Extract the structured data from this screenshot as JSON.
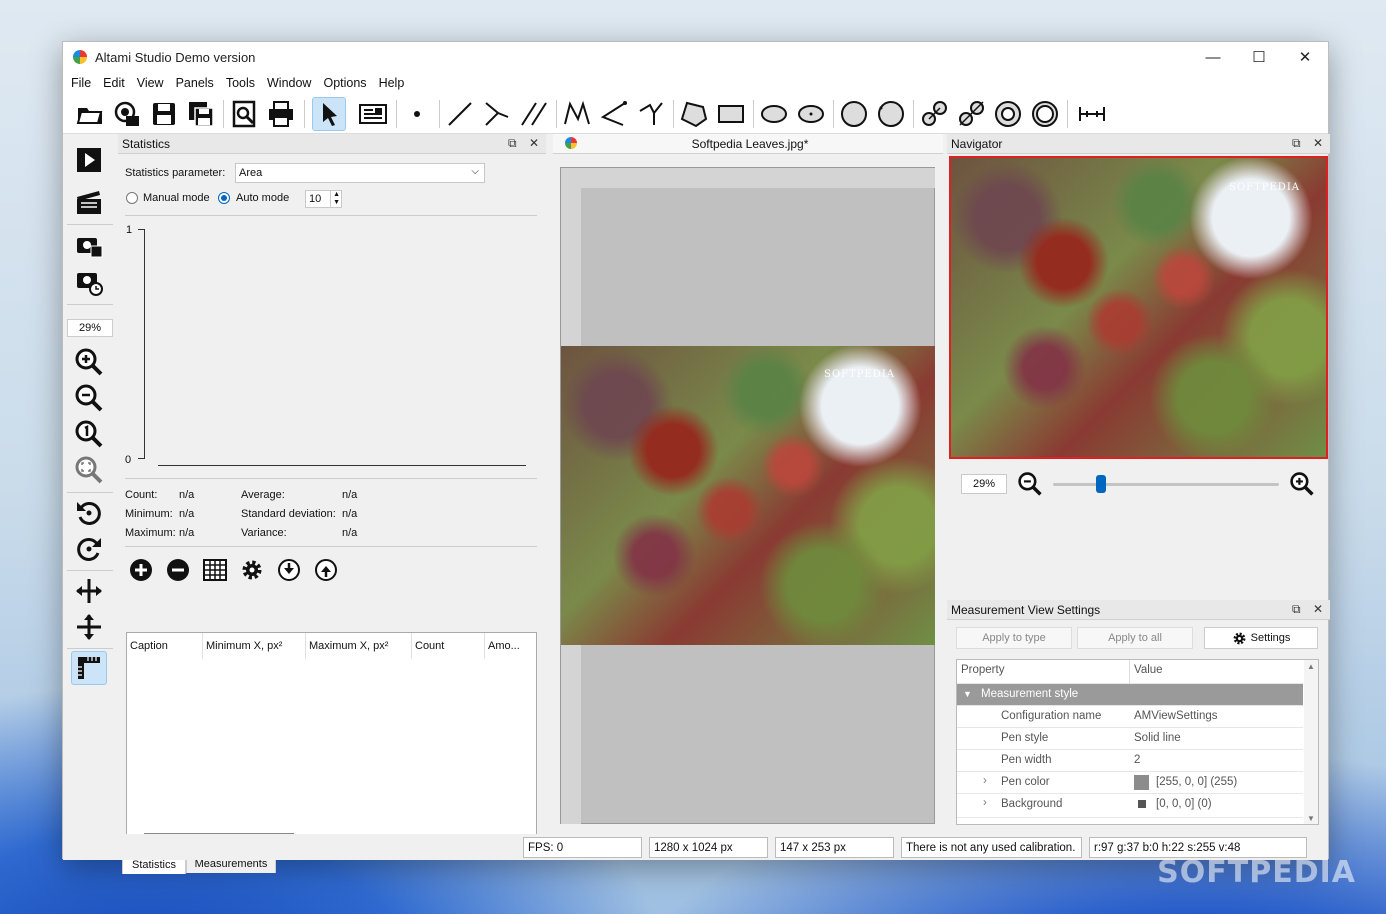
{
  "window": {
    "title": "Altami Studio Demo version",
    "minimize": "—",
    "maximize": "☐",
    "close": "✕"
  },
  "menu": [
    "File",
    "Edit",
    "View",
    "Panels",
    "Tools",
    "Window",
    "Options",
    "Help"
  ],
  "left_toolbar": {
    "zoom_value": "29%"
  },
  "statistics": {
    "panel_title": "Statistics",
    "param_label": "Statistics parameter:",
    "param_value": "Area",
    "manual_mode": "Manual mode",
    "auto_mode": "Auto mode",
    "auto_count": "10",
    "chart": {
      "ymax": "1",
      "ymin": "0"
    },
    "count_label": "Count:",
    "count_value": "n/a",
    "minimum_label": "Minimum:",
    "minimum_value": "n/a",
    "maximum_label": "Maximum:",
    "maximum_value": "n/a",
    "average_label": "Average:",
    "average_value": "n/a",
    "stddev_label": "Standard deviation:",
    "stddev_value": "n/a",
    "variance_label": "Variance:",
    "variance_value": "n/a",
    "table_columns": [
      "Caption",
      "Minimum X, px²",
      "Maximum X, px²",
      "Count",
      "Amo..."
    ],
    "bottom_tabs": [
      "Statistics",
      "Measurements"
    ]
  },
  "document": {
    "tab_title": "Softpedia Leaves.jpg*",
    "image_watermark": "SOFTPEDIA"
  },
  "navigator": {
    "panel_title": "Navigator",
    "zoom_value": "29%",
    "image_watermark": "SOFTPEDIA",
    "zoom_level": 0.2
  },
  "measurement_settings": {
    "panel_title": "Measurement View Settings",
    "apply_to_type": "Apply to type",
    "apply_to_all": "Apply to all",
    "settings": "Settings",
    "col_property": "Property",
    "col_value": "Value",
    "group": "Measurement style",
    "rows": [
      {
        "property": "Configuration name",
        "value": "AMViewSettings"
      },
      {
        "property": "Pen style",
        "value": "Solid line"
      },
      {
        "property": "Pen width",
        "value": "2"
      },
      {
        "property": "Pen color",
        "value": "[255, 0, 0] (255)",
        "swatch": "#8c8c8c"
      },
      {
        "property": "Background",
        "value": "[0, 0, 0] (0)",
        "swatch": "#555555"
      }
    ]
  },
  "status": {
    "fps": "FPS: 0",
    "image_size": "1280 x 1024 px",
    "cursor": "147 x 253 px",
    "calibration": "There is not any used calibration.",
    "pixel": "r:97 g:37 b:0 h:22 s:255 v:48"
  },
  "colors": {
    "accent": "#0067c0",
    "nav_border": "#e02020",
    "selection": "#cce4f7"
  },
  "desktop_watermark": "SOFTPEDIA"
}
